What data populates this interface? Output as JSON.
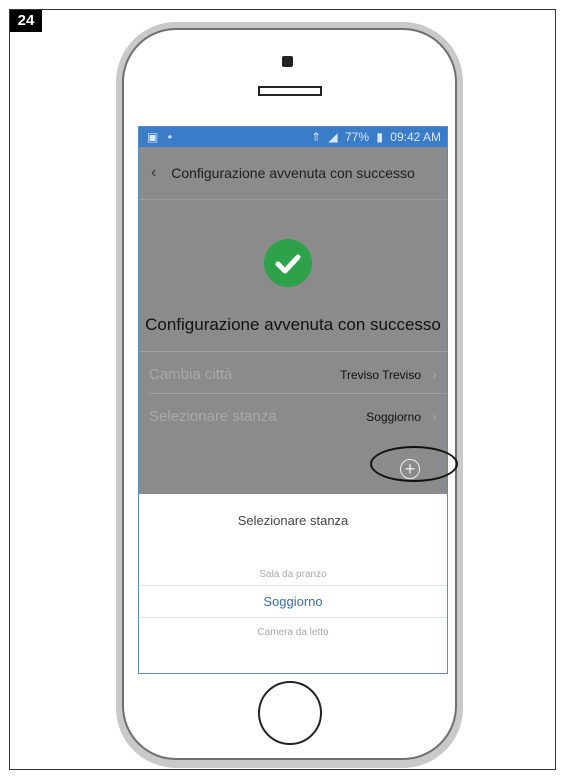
{
  "step": {
    "number": "24"
  },
  "status_bar": {
    "battery_percent": "77%",
    "time": "09:42 AM"
  },
  "nav": {
    "back_icon": "chevron-left-icon",
    "title": "Configurazione avvenuta con successo"
  },
  "confirmation": {
    "icon": "check-circle-icon",
    "heading": "Configurazione avvenuta con successo"
  },
  "settings": {
    "rows": [
      {
        "label": "Cambia città",
        "value": "Treviso Treviso"
      },
      {
        "label": "Selezionare stanza",
        "value": "Soggiorno"
      }
    ],
    "add_icon": "plus-circle-icon"
  },
  "picker": {
    "title": "Selezionare stanza",
    "options": [
      {
        "label": "Sala da pranzo",
        "selected": false
      },
      {
        "label": "Soggiorno",
        "selected": true
      },
      {
        "label": "Camera da letto",
        "selected": false
      }
    ]
  },
  "colors": {
    "status_bar": "#3b7cc8",
    "success_green": "#2ea14b",
    "selected_option": "#3a6ea8",
    "overlay_gray": "#8b8b8b"
  }
}
